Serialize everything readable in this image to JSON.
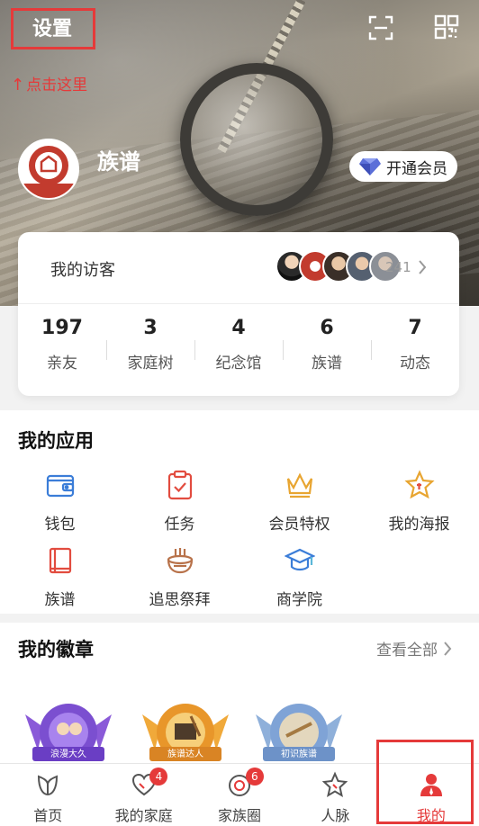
{
  "header": {
    "settings_label": "设置",
    "hint_text": "点击这里",
    "scan_icon": "scan-icon",
    "qr_icon": "qr-code-icon"
  },
  "profile": {
    "name": "族谱",
    "vip_button_label": "开通会员",
    "vip_icon": "diamond-icon"
  },
  "visitors": {
    "label": "我的访客",
    "count": "241"
  },
  "stats": [
    {
      "value": "197",
      "label": "亲友"
    },
    {
      "value": "3",
      "label": "家庭树"
    },
    {
      "value": "4",
      "label": "纪念馆"
    },
    {
      "value": "6",
      "label": "族谱"
    },
    {
      "value": "7",
      "label": "动态"
    }
  ],
  "apps": {
    "title": "我的应用",
    "items": [
      {
        "label": "钱包",
        "icon": "wallet-icon"
      },
      {
        "label": "任务",
        "icon": "clipboard-check-icon"
      },
      {
        "label": "会员特权",
        "icon": "crown-icon"
      },
      {
        "label": "我的海报",
        "icon": "star-poster-icon"
      },
      {
        "label": "族谱",
        "icon": "book-icon"
      },
      {
        "label": "追思祭拜",
        "icon": "incense-bowl-icon"
      },
      {
        "label": "商学院",
        "icon": "graduation-cap-icon"
      }
    ]
  },
  "badges": {
    "title": "我的徽章",
    "view_all": "查看全部",
    "items": [
      {
        "caption": "浪漫大久"
      },
      {
        "caption": "族谱达人"
      },
      {
        "caption": "初识族谱"
      }
    ]
  },
  "tabs": [
    {
      "label": "首页",
      "icon": "home-leaf-icon",
      "badge": ""
    },
    {
      "label": "我的家庭",
      "icon": "heart-icon",
      "badge": "4"
    },
    {
      "label": "家族圈",
      "icon": "circle-icon",
      "badge": "6"
    },
    {
      "label": "人脉",
      "icon": "star-icon",
      "badge": ""
    },
    {
      "label": "我的",
      "icon": "person-icon",
      "badge": ""
    }
  ],
  "colors": {
    "accent": "#e53a3a",
    "app_blue": "#3b7dd8",
    "app_red": "#e24c3f",
    "app_gold": "#e8a531",
    "app_brown": "#b8724a"
  }
}
